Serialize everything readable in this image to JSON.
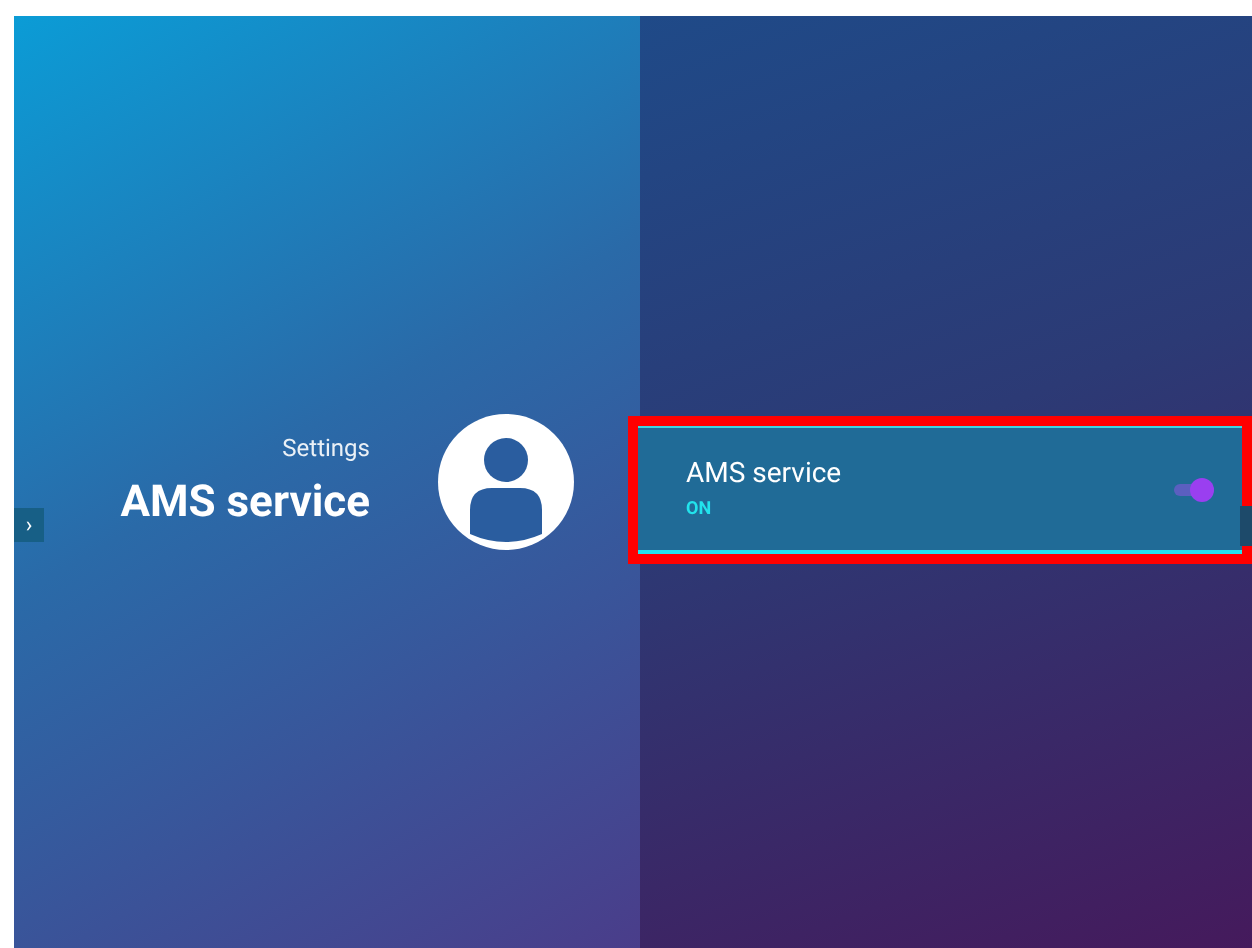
{
  "header": {
    "breadcrumb": "Settings",
    "title": "AMS service"
  },
  "back_button": {
    "label": "›"
  },
  "items": [
    {
      "kind": "toggle",
      "title": "AMS service",
      "status": "ON",
      "on": true,
      "highlighted": true
    }
  ]
}
